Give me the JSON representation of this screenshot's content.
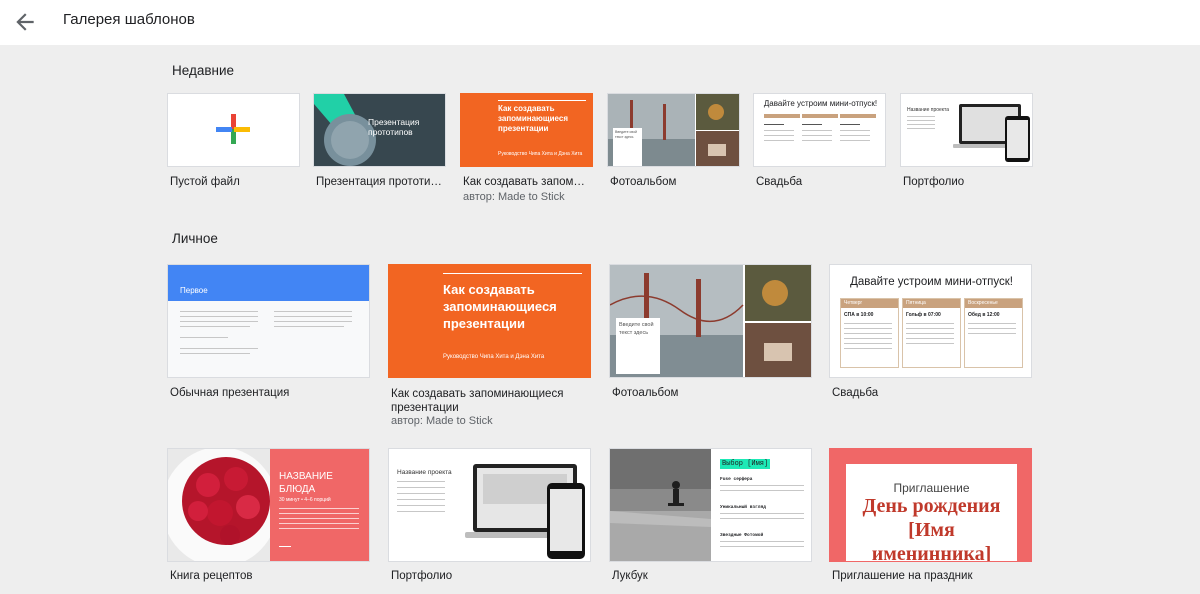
{
  "header": {
    "title": "Галерея шаблонов",
    "back_icon": "arrow-back-icon"
  },
  "sections": {
    "recent": {
      "title": "Недавние"
    },
    "personal": {
      "title": "Личное"
    }
  },
  "recent": [
    {
      "name": "Пустой файл"
    },
    {
      "name": "Презентация прототипов",
      "thumb_title": "Презентация прототипов"
    },
    {
      "name": "Как создавать запоминающиеся презентации",
      "author": "автор: Made to Stick",
      "thumb_title": "Как создавать запоминающиеся презентации",
      "thumb_sub": "Руководство Чипа Хита и Дэна Хита"
    },
    {
      "name": "Фотоальбом",
      "thumb_text": "Введите свой текст здесь"
    },
    {
      "name": "Свадьба",
      "thumb_title": "Давайте устроим мини-отпуск!"
    },
    {
      "name": "Портфолио",
      "thumb_title": "Название проекта"
    }
  ],
  "personal": [
    {
      "name": "Обычная презентация",
      "thumb_title": "Первое"
    },
    {
      "name": "Как создавать запоминающиеся презентации",
      "author": "автор: Made to Stick",
      "thumb_title": "Как создавать запоминающиеся презентации",
      "thumb_sub": "Руководство Чипа Хита и Дэна Хита"
    },
    {
      "name": "Фотоальбом",
      "thumb_text": "Введите свой текст здесь"
    },
    {
      "name": "Свадьба",
      "thumb_title": "Давайте устроим мини-отпуск!",
      "cols": [
        "Четверг",
        "Пятница",
        "Воскресенье"
      ],
      "times": [
        "СПА в 10:00",
        "Гольф в 07:00",
        "Обед в 12:00"
      ]
    },
    {
      "name": "Книга рецептов",
      "thumb_title": "НАЗВАНИЕ БЛЮДА",
      "thumb_sub": "30 минут • 4–6 порций"
    },
    {
      "name": "Портфолио",
      "thumb_title": "Название проекта"
    },
    {
      "name": "Лукбук",
      "thumb_title": "Выбор [Имя]",
      "labels": [
        "Fuse серфера",
        "Уникальный взгляд",
        "Звездные Фотомой"
      ]
    },
    {
      "name": "Приглашение на праздник",
      "thumb_title": "Приглашение",
      "thumb_big": "День рождения [Имя именинника]"
    }
  ],
  "colors": {
    "orange": "#f26522",
    "blue": "#4285f4",
    "tan": "#c9a27e",
    "coral": "#f06767",
    "invite_red": "#c0392b"
  }
}
